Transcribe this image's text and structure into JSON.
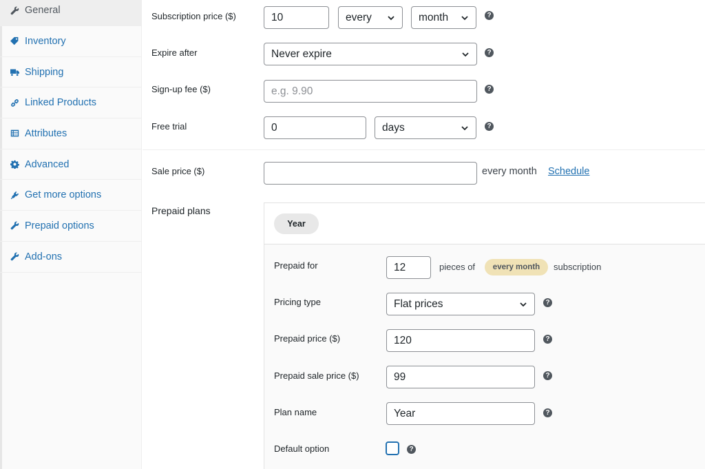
{
  "sidebar": {
    "items": [
      {
        "label": "General",
        "icon": "wrench-icon"
      },
      {
        "label": "Inventory",
        "icon": "tag-icon"
      },
      {
        "label": "Shipping",
        "icon": "truck-icon"
      },
      {
        "label": "Linked Products",
        "icon": "link-icon"
      },
      {
        "label": "Attributes",
        "icon": "list-table-icon"
      },
      {
        "label": "Advanced",
        "icon": "gear-icon"
      },
      {
        "label": "Get more options",
        "icon": "plugin-icon"
      },
      {
        "label": "Prepaid options",
        "icon": "wrench-icon"
      },
      {
        "label": "Add-ons",
        "icon": "wrench-icon"
      }
    ]
  },
  "subscription": {
    "price_label": "Subscription price ($)",
    "price_value": "10",
    "interval_value": "every",
    "period_value": "month",
    "expire_label": "Expire after",
    "expire_value": "Never expire",
    "signup_label": "Sign-up fee ($)",
    "signup_placeholder": "e.g. 9.90",
    "trial_label": "Free trial",
    "trial_value": "0",
    "trial_period_value": "days"
  },
  "sale": {
    "label": "Sale price ($)",
    "value": "",
    "suffix": "every month",
    "schedule_link": "Schedule"
  },
  "prepaid": {
    "section_label": "Prepaid plans",
    "tab_label": "Year",
    "prepaid_for_label": "Prepaid for",
    "prepaid_for_value": "12",
    "pieces_of": "pieces of",
    "badge": "every month",
    "subscription_suffix": "subscription",
    "pricing_type_label": "Pricing type",
    "pricing_type_value": "Flat prices",
    "price_label": "Prepaid price ($)",
    "price_value": "120",
    "sale_price_label": "Prepaid sale price ($)",
    "sale_price_value": "99",
    "plan_name_label": "Plan name",
    "plan_name_value": "Year",
    "default_option_label": "Default option",
    "default_option_checked": false
  },
  "help_glyph": "?",
  "colors": {
    "link": "#2271b1",
    "badge_bg": "#f0e2b6",
    "help_bg": "#50575e"
  }
}
